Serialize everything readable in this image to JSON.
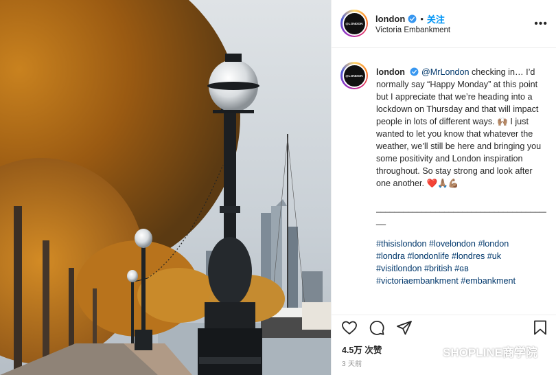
{
  "post": {
    "username": "london",
    "location": "Victoria Embankment",
    "follow_label": "关注",
    "dot": "•",
    "more_icon": "more-horizontal-icon"
  },
  "avatar": {
    "text": "@LONDON"
  },
  "caption": {
    "username": "london",
    "mention": "@MrLondon",
    "text": " checking in… I’d normally say “Happy Monday” at this point but I appreciate that we’re heading into a lockdown on Thursday and that will impact people in lots of different ways. ",
    "emoji_1": "🙌🏽",
    "text_2": " I just wanted to let you know that whatever the weather, we’ll still be here and bringing you some positivity and London inspiration throughout. So stay strong and look after one another. ",
    "emoji_2": "❤️🙏🏽💪🏽",
    "rule": "_______________________________________",
    "rule_2": "__",
    "hashtags": [
      "#thisislondon",
      "#lovelondon",
      "#london",
      "#londra",
      "#londonlife",
      "#londres",
      "#uk",
      "#visitlondon",
      "#british",
      "#ɢʙ",
      "#victoriaembankment",
      "#embankment"
    ]
  },
  "actions": {
    "icons": [
      "heart-icon",
      "comment-icon",
      "share-icon",
      "bookmark-icon"
    ],
    "likes_count": "4.5万",
    "likes_label": "次赞",
    "time_ago": "3 天前"
  },
  "watermark": {
    "text": "SHOPLINE商学院"
  },
  "colors": {
    "link": "#0095f6",
    "hashtag": "#00376b",
    "muted": "#8e8e8e",
    "heart": "#ed4956"
  }
}
